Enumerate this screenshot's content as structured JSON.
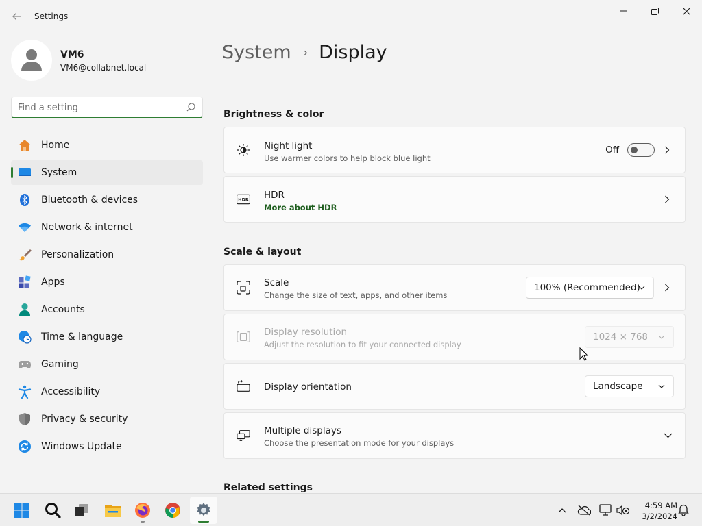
{
  "window": {
    "title": "Settings",
    "back_icon": "arrow-left-icon",
    "controls": [
      "minimize-icon",
      "maximize-icon",
      "close-icon"
    ]
  },
  "profile": {
    "name": "VM6",
    "email": "VM6@collabnet.local"
  },
  "search": {
    "placeholder": "Find a setting",
    "value": ""
  },
  "nav": {
    "selected": "System",
    "items": [
      {
        "label": "Home",
        "icon": "home-icon"
      },
      {
        "label": "System",
        "icon": "monitor-icon"
      },
      {
        "label": "Bluetooth & devices",
        "icon": "bluetooth-icon"
      },
      {
        "label": "Network & internet",
        "icon": "wifi-icon"
      },
      {
        "label": "Personalization",
        "icon": "brush-icon"
      },
      {
        "label": "Apps",
        "icon": "apps-icon"
      },
      {
        "label": "Accounts",
        "icon": "person-icon"
      },
      {
        "label": "Time & language",
        "icon": "clock-globe-icon"
      },
      {
        "label": "Gaming",
        "icon": "gamepad-icon"
      },
      {
        "label": "Accessibility",
        "icon": "accessibility-icon"
      },
      {
        "label": "Privacy & security",
        "icon": "shield-icon"
      },
      {
        "label": "Windows Update",
        "icon": "update-icon"
      }
    ]
  },
  "breadcrumb": {
    "parent": "System",
    "separator": "›",
    "current": "Display"
  },
  "sections": {
    "brightness": "Brightness & color",
    "scale_layout": "Scale & layout",
    "related": "Related settings"
  },
  "cards": {
    "night_light": {
      "title": "Night light",
      "subtitle": "Use warmer colors to help block blue light",
      "state_label": "Off",
      "on": false
    },
    "hdr": {
      "title": "HDR",
      "link": "More about HDR"
    },
    "scale": {
      "title": "Scale",
      "subtitle": "Change the size of text, apps, and other items",
      "value": "100% (Recommended)"
    },
    "resolution": {
      "title": "Display resolution",
      "subtitle": "Adjust the resolution to fit your connected display",
      "value": "1024 × 768",
      "disabled": true
    },
    "orientation": {
      "title": "Display orientation",
      "value": "Landscape"
    },
    "multiple": {
      "title": "Multiple displays",
      "subtitle": "Choose the presentation mode for your displays"
    }
  },
  "taskbar": {
    "apps": [
      "start-icon",
      "search-icon",
      "task-view-icon",
      "file-explorer-icon",
      "firefox-icon",
      "chrome-icon",
      "settings-icon"
    ],
    "active_app": "settings-icon",
    "tray": [
      "chevron-up-icon",
      "onedrive-icon",
      "network-icon",
      "volume-muted-icon",
      "notification-bell-icon"
    ],
    "time": "4:59 AM",
    "date": "3/2/2024"
  },
  "colors": {
    "accent": "#2e7d32",
    "link": "#1e5e1e",
    "background": "#f3f3f3",
    "card": "#fbfbfb"
  }
}
